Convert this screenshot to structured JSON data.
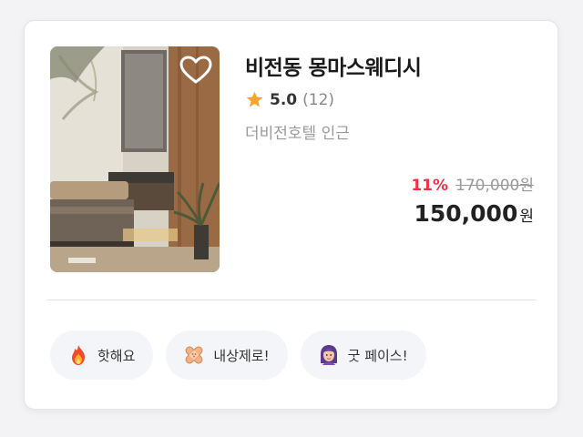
{
  "listing": {
    "title": "비전동 몽마스웨디시",
    "rating": "5.0",
    "review_count": "(12)",
    "location": "더비전호텔 인근",
    "discount": "11%",
    "original_price": "170,000원",
    "sale_price": "150,000",
    "sale_unit": "원"
  },
  "icons": {
    "favorite": "heart-outline-icon",
    "rating": "star-icon"
  },
  "tags": [
    {
      "icon": "fire-icon",
      "label": "핫해요"
    },
    {
      "icon": "bandage-icon",
      "label": "내상제로!"
    },
    {
      "icon": "face-avatar-icon",
      "label": "굿 페이스!"
    }
  ],
  "colors": {
    "discount": "#ee3344",
    "star": "#f5a623",
    "muted_text": "#9a9a9a",
    "tag_background": "#f4f5f8"
  }
}
